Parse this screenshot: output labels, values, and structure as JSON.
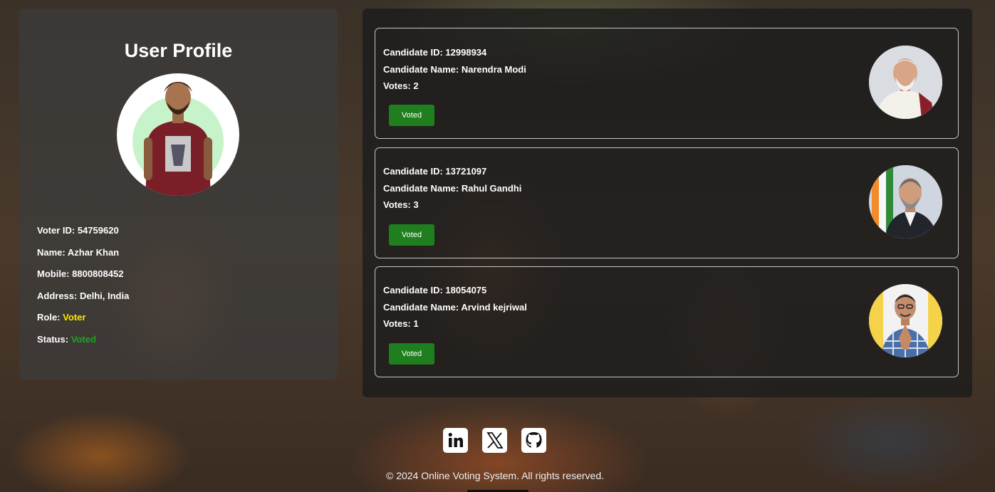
{
  "profile": {
    "title": "User Profile",
    "fields": [
      {
        "label": "Voter ID:",
        "value": "54759620"
      },
      {
        "label": "Name:",
        "value": "Azhar Khan"
      },
      {
        "label": "Mobile:",
        "value": "8800808452"
      },
      {
        "label": "Address:",
        "value": "Delhi, India"
      },
      {
        "label": "Role:",
        "value": "Voter"
      },
      {
        "label": "Status:",
        "value": "Voted"
      }
    ]
  },
  "candidates": [
    {
      "id_label": "Candidate ID:",
      "id": "12998934",
      "name_label": "Candidate Name:",
      "name": "Narendra Modi",
      "votes_label": "Votes:",
      "votes": "2",
      "button": "Voted"
    },
    {
      "id_label": "Candidate ID:",
      "id": "13721097",
      "name_label": "Candidate Name:",
      "name": "Rahul Gandhi",
      "votes_label": "Votes:",
      "votes": "3",
      "button": "Voted"
    },
    {
      "id_label": "Candidate ID:",
      "id": "18054075",
      "name_label": "Candidate Name:",
      "name": "Arvind kejriwal",
      "votes_label": "Votes:",
      "votes": "1",
      "button": "Voted"
    }
  ],
  "social": [
    "linkedin-icon",
    "x-twitter-icon",
    "github-icon"
  ],
  "footer": {
    "copyright": "© 2024 Online Voting System. All rights reserved."
  },
  "colors": {
    "role": "#ffe600",
    "status": "#1fa51f",
    "button": "#1f7f1f"
  }
}
